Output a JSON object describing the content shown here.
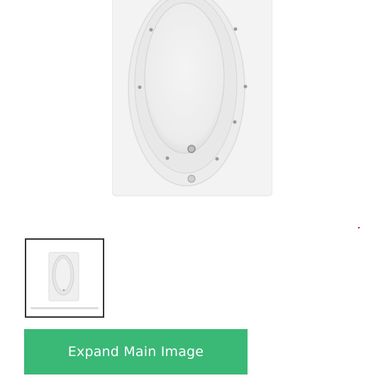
{
  "gallery": {
    "main_image_icon": "bathtub-image",
    "thumbnail_icon": "bathtub-thumbnail",
    "expand_label": "Expand Main Image",
    "accent_color": "#3ab876",
    "thumbnail_border_color": "#333333"
  }
}
